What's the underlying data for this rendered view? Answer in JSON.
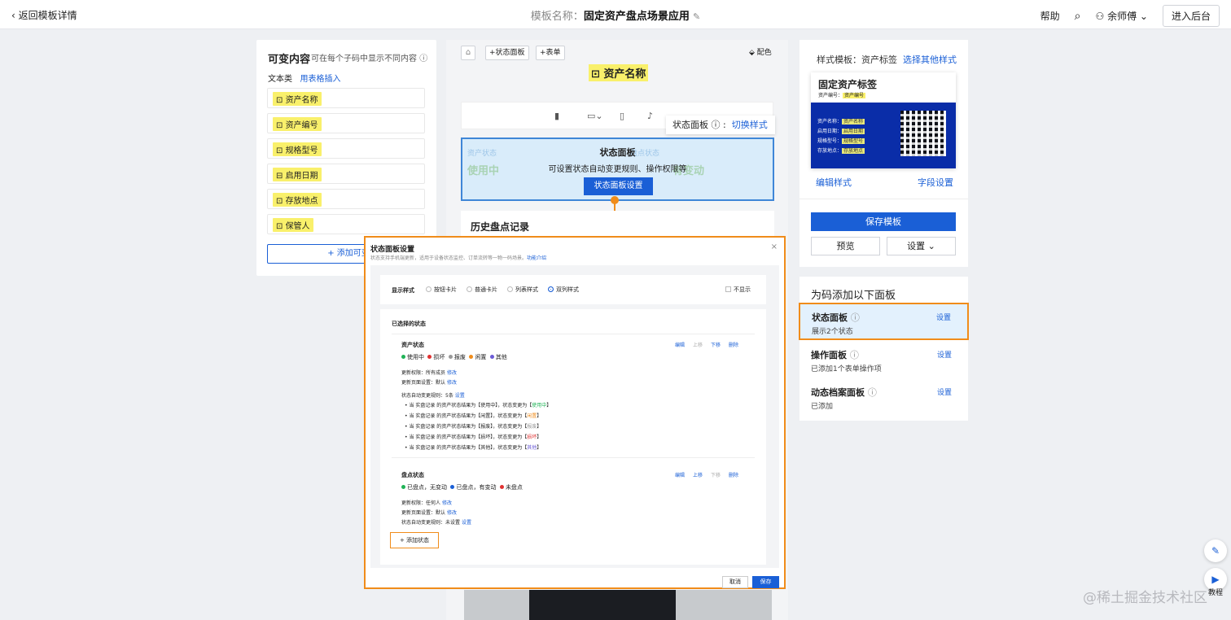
{
  "topbar": {
    "back": "返回模板详情",
    "template_label": "模板名称：",
    "template_name": "固定资产盘点场景应用",
    "help": "帮助",
    "user": "余师傅",
    "enter_admin": "进入后台"
  },
  "left": {
    "title": "可变内容",
    "subtitle": "可在每个子码中显示不同内容",
    "category": "文本类",
    "table_insert": "用表格插入",
    "fields": [
      "资产名称",
      "资产编号",
      "规格型号",
      "启用日期",
      "存放地点",
      "保管人"
    ],
    "add_variable": "+ 添加可变内"
  },
  "center": {
    "tag_status": "+状态面板",
    "tag_form": "+表单",
    "color": "配色",
    "asset_name": "资产名称",
    "tip_label": "状态面板",
    "tip_action": "切换样式",
    "ghost_left_label": "资产状态",
    "ghost_left_value": "使用中",
    "ghost_right_label": "盘点状态",
    "ghost_right_value": "有变动",
    "panel_title": "状态面板",
    "panel_desc": "可设置状态自动变更规则、操作权限等",
    "panel_button": "状态面板设置",
    "history": "历史盘点记录"
  },
  "modal": {
    "title": "状态面板设置",
    "subtitle": "状态支持手机端更新，适用于设备状态监控、订单流转等一物一码场景。",
    "intro": "功能介绍",
    "display_style": "显示样式",
    "styles": [
      "按钮卡片",
      "普通卡片",
      "列表样式",
      "双列样式"
    ],
    "hide": "不显示",
    "selected": "已选择的状态",
    "state1": {
      "name": "资产状态",
      "values": [
        "使用中",
        "损坏",
        "报废",
        "闲置",
        "其他"
      ],
      "ops": [
        "编辑",
        "上移",
        "下移",
        "删除"
      ],
      "perm": "更新权限：所有成员",
      "page": "更新页面设置：默认",
      "rule": "状态自动变更规则：5条",
      "edit": "修改",
      "set": "设置",
      "rules": [
        {
          "pre": "当 实盘记录 的资产状态结果为【使用中】，状态变更为【",
          "v": "使用中",
          "post": "】"
        },
        {
          "pre": "当 实盘记录 的资产状态结果为【闲置】，状态变更为【",
          "v": "闲置",
          "post": "】"
        },
        {
          "pre": "当 实盘记录 的资产状态结果为【报废】，状态变更为【",
          "v": "报废",
          "post": "】"
        },
        {
          "pre": "当 实盘记录 的资产状态结果为【损坏】，状态变更为【",
          "v": "损坏",
          "post": "】"
        },
        {
          "pre": "当 实盘记录 的资产状态结果为【其他】，状态变更为【",
          "v": "其他",
          "post": "】"
        }
      ]
    },
    "state2": {
      "name": "盘点状态",
      "values": [
        "已盘点，无变动",
        "已盘点，有变动",
        "未盘点"
      ],
      "ops": [
        "编辑",
        "上移",
        "下移",
        "删除"
      ],
      "perm": "更新权限：任何人",
      "page": "更新页面设置：默认",
      "rule": "状态自动变更规则：未设置",
      "edit": "修改",
      "set": "设置"
    },
    "add_state": "+ 添加状态",
    "cancel": "取消",
    "save": "保存"
  },
  "right": {
    "style_label": "样式模板：资产标签",
    "choose_style": "选择其他样式",
    "card_title": "固定资产标签",
    "card_no_label": "资产编号：",
    "card_no_value": "资产编号",
    "card_rows": [
      {
        "k": "资产名称：",
        "v": "资产名称"
      },
      {
        "k": "启用日期：",
        "v": "启用日期"
      },
      {
        "k": "规格型号：",
        "v": "规格型号"
      },
      {
        "k": "存放地点：",
        "v": "存放地点"
      }
    ],
    "edit_style": "编辑样式",
    "field_settings": "字段设置",
    "save_template": "保存模板",
    "preview": "预览",
    "settings": "设置",
    "add_panels_title": "为码添加以下面板",
    "panels": [
      {
        "title": "状态面板",
        "sub": "展示2个状态",
        "set": "设置"
      },
      {
        "title": "操作面板",
        "sub": "已添加1个表单操作项",
        "set": "设置"
      },
      {
        "title": "动态档案面板",
        "sub": "已添加",
        "set": "设置"
      }
    ]
  },
  "side": {
    "tutorial": "教程"
  },
  "watermark": "@稀土掘金技术社区",
  "colors": {
    "accent": "#1a5fd6",
    "highlight": "#f08c1a",
    "chip": "#f9f06b"
  }
}
